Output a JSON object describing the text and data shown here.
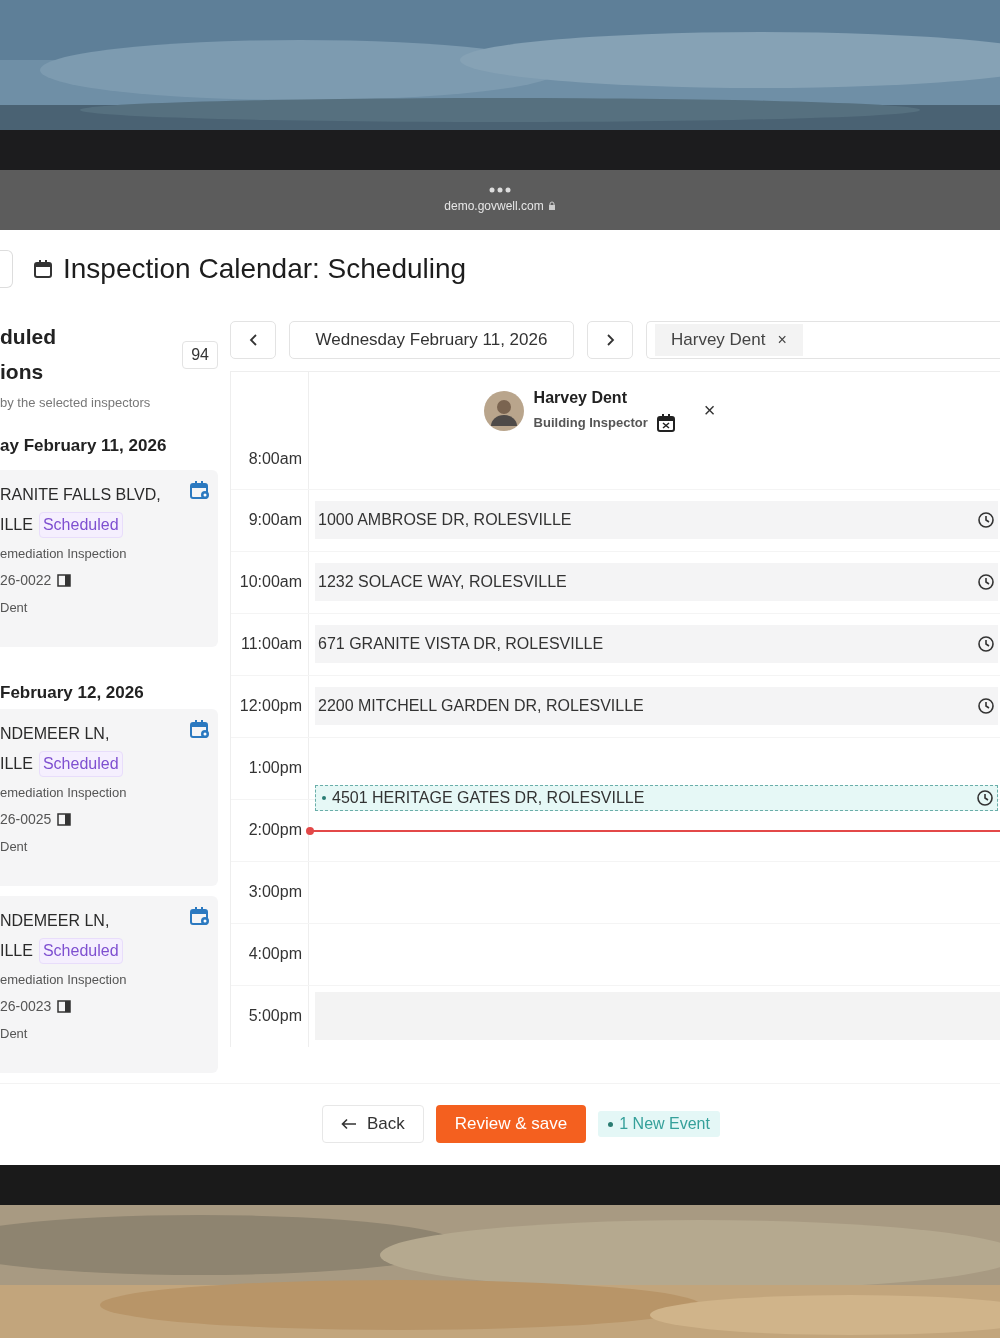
{
  "browser": {
    "url": "demo.govwell.com"
  },
  "page": {
    "title": "Inspection Calendar: Scheduling"
  },
  "sidebar": {
    "title_lines": [
      "duled",
      "ions"
    ],
    "count": "94",
    "subtitle": "by the selected inspectors",
    "groups": [
      {
        "date": "ay February 11, 2026",
        "items": [
          {
            "address_lines": [
              "RANITE FALLS BLVD,",
              "ILLE"
            ],
            "status": "Scheduled",
            "type": "emediation Inspection",
            "record": "26-0022",
            "inspector": "Dent"
          }
        ]
      },
      {
        "date": "February 12, 2026",
        "items": [
          {
            "address_lines": [
              "NDEMEER LN,",
              "ILLE"
            ],
            "status": "Scheduled",
            "type": "emediation Inspection",
            "record": "26-0025",
            "inspector": "Dent"
          },
          {
            "address_lines": [
              "NDEMEER LN,",
              "ILLE"
            ],
            "status": "Scheduled",
            "type": "emediation Inspection",
            "record": "26-0023",
            "inspector": "Dent"
          }
        ]
      }
    ]
  },
  "toolbar": {
    "date": "Wednesday February 11, 2026",
    "chips": [
      {
        "label": "Harvey Dent",
        "remove": "×"
      }
    ]
  },
  "inspector": {
    "name": "Harvey Dent",
    "role": "Building Inspector",
    "close": "×"
  },
  "hours": [
    {
      "time": "8:00am"
    },
    {
      "time": "9:00am",
      "events": [
        {
          "address": "1000 AMBROSE DR, ROLESVILLE",
          "kind": "scheduled"
        }
      ]
    },
    {
      "time": "10:00am",
      "events": [
        {
          "address": "1232 SOLACE WAY, ROLESVILLE",
          "kind": "scheduled"
        }
      ]
    },
    {
      "time": "11:00am",
      "events": [
        {
          "address": "671 GRANITE VISTA DR, ROLESVILLE",
          "kind": "scheduled"
        }
      ]
    },
    {
      "time": "12:00pm",
      "events": [
        {
          "address": "2200 MITCHELL GARDEN DR, ROLESVILLE",
          "kind": "scheduled"
        }
      ]
    },
    {
      "time": "1:00pm",
      "events": [
        {
          "address": "4501 HERITAGE GATES DR, ROLESVILLE",
          "kind": "new"
        }
      ]
    },
    {
      "time": "2:00pm",
      "now": true
    },
    {
      "time": "3:00pm"
    },
    {
      "time": "4:00pm"
    },
    {
      "time": "5:00pm",
      "unavailable": true
    }
  ],
  "footer": {
    "back": "Back",
    "save": "Review & save",
    "new_events": "1 New Event"
  }
}
